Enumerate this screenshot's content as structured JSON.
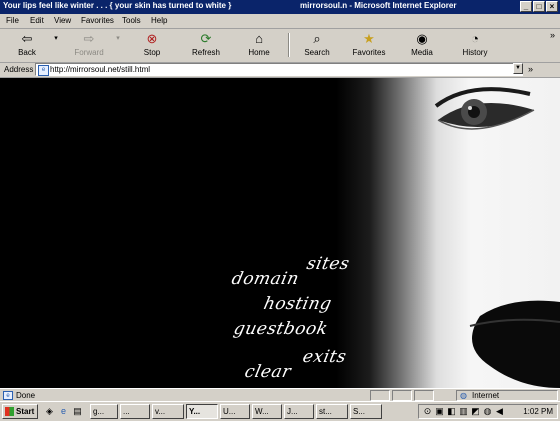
{
  "window": {
    "title_left": "Your lips feel like winter . . . { your skin has turned to white }",
    "title_right": "mirrorsoul.n - Microsoft Internet Explorer"
  },
  "menu": [
    "File",
    "Edit",
    "View",
    "Favorites",
    "Tools",
    "Help"
  ],
  "toolbar": {
    "back": "Back",
    "forward": "Forward",
    "stop": "Stop",
    "refresh": "Refresh",
    "home": "Home",
    "search": "Search",
    "favorites": "Favorites",
    "media": "Media",
    "history": "History",
    "more": "»"
  },
  "address": {
    "label": "Address",
    "url": "http://mirrorsoul.net/still.html",
    "more": "»"
  },
  "nav": {
    "sites": "sites",
    "domain": "domain",
    "hosting": "hosting",
    "guestbook": "guestbook",
    "exits": "exits",
    "clear": "clear"
  },
  "status": {
    "text": "Done",
    "zone": "Internet"
  },
  "taskbar": {
    "start": "Start",
    "tasks": [
      "g...",
      "...",
      "v...",
      "Y...",
      "U...",
      "W...",
      "J...",
      "st...",
      "S..."
    ],
    "clock": "1:02 PM"
  },
  "colors": {
    "titlebar": "#0a246a",
    "chrome": "#d4d0c8",
    "page_bg": "#000000",
    "nav_text": "#ffffff"
  }
}
